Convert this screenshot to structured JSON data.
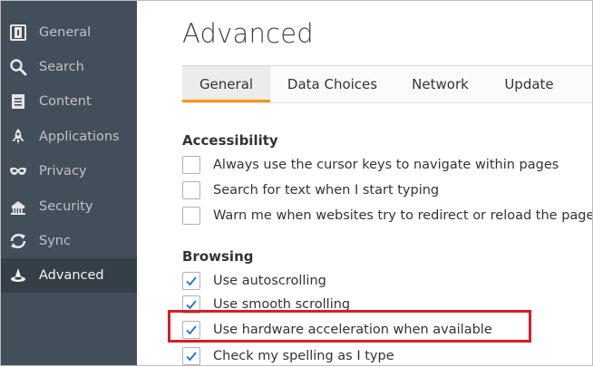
{
  "sidebar": {
    "items": [
      {
        "label": "General",
        "icon": "general-icon",
        "active": false
      },
      {
        "label": "Search",
        "icon": "search-icon",
        "active": false
      },
      {
        "label": "Content",
        "icon": "content-icon",
        "active": false
      },
      {
        "label": "Applications",
        "icon": "applications-icon",
        "active": false
      },
      {
        "label": "Privacy",
        "icon": "privacy-mask-icon",
        "active": false
      },
      {
        "label": "Security",
        "icon": "security-icon",
        "active": false
      },
      {
        "label": "Sync",
        "icon": "sync-icon",
        "active": false
      },
      {
        "label": "Advanced",
        "icon": "advanced-icon",
        "active": true
      }
    ]
  },
  "main": {
    "title": "Advanced",
    "tabs": [
      {
        "label": "General",
        "active": true
      },
      {
        "label": "Data Choices",
        "active": false
      },
      {
        "label": "Network",
        "active": false
      },
      {
        "label": "Update",
        "active": false
      }
    ],
    "accessibility": {
      "title": "Accessibility",
      "options": [
        {
          "label": "Always use the cursor keys to navigate within pages",
          "checked": false
        },
        {
          "label": "Search for text when I start typing",
          "checked": false
        },
        {
          "label": "Warn me when websites try to redirect or reload the page",
          "checked": false
        }
      ]
    },
    "browsing": {
      "title": "Browsing",
      "options": [
        {
          "label": "Use autoscrolling",
          "checked": true
        },
        {
          "label": "Use smooth scrolling",
          "checked": true
        },
        {
          "label": "Use hardware acceleration when available",
          "checked": true,
          "highlighted": true
        },
        {
          "label": "Check my spelling as I type",
          "checked": true
        }
      ]
    }
  },
  "colors": {
    "sidebar_bg": "#424f5a",
    "sidebar_active_bg": "#343f48",
    "tab_accent": "#ff9500",
    "highlight_box": "#d71d28",
    "checkmark": "#1a73c7"
  }
}
